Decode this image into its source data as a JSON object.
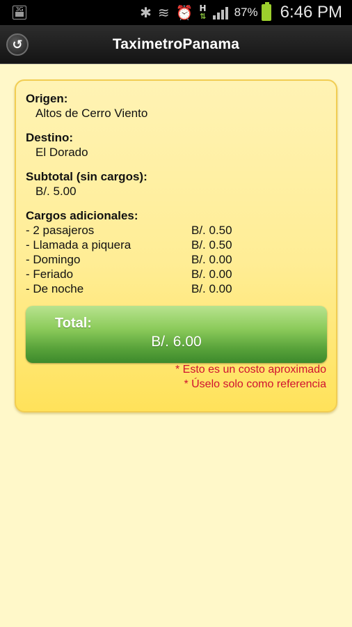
{
  "status_bar": {
    "sim_label": "3G",
    "battery_percent": "87%",
    "time": "6:46 PM",
    "network_type": "H",
    "icons": [
      "sim-icon",
      "bluetooth-icon",
      "vibrate-icon",
      "alarm-icon",
      "hplus-data-icon",
      "signal-icon",
      "battery-icon"
    ]
  },
  "action_bar": {
    "title": "TaximetroPanama",
    "back_icon": "back-arrow-icon"
  },
  "trip": {
    "origin_label": "Origen:",
    "origin_value": "Altos de Cerro Viento",
    "destination_label": "Destino:",
    "destination_value": "El Dorado",
    "subtotal_label": "Subtotal (sin cargos):",
    "subtotal_value": "B/. 5.00",
    "charges_label": "Cargos adicionales:",
    "charges": [
      {
        "name": "- 2 pasajeros",
        "amount": "B/. 0.50"
      },
      {
        "name": "- Llamada a piquera",
        "amount": "B/. 0.50"
      },
      {
        "name": "- Domingo",
        "amount": "B/. 0.00"
      },
      {
        "name": "- Feriado",
        "amount": "B/. 0.00"
      },
      {
        "name": "- De noche",
        "amount": "B/. 0.00"
      }
    ],
    "total_label": "Total:",
    "total_value": "B/. 6.00",
    "notes": [
      "* Esto es un costo aproximado",
      "* Úselo solo como referencia"
    ]
  },
  "colors": {
    "background": "#fff8c9",
    "card": "#ffed95",
    "total_button": "#58a23a",
    "note_text": "#cf1030"
  }
}
